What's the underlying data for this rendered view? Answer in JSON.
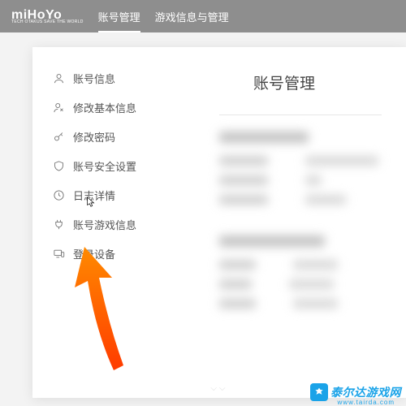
{
  "logo": {
    "main": "miHoYo",
    "sub": "TECH OTAKUS SAVE THE WORLD"
  },
  "nav": {
    "items": [
      {
        "label": "账号管理",
        "active": true
      },
      {
        "label": "游戏信息与管理",
        "active": false
      }
    ]
  },
  "sidebar": {
    "items": [
      {
        "icon": "user-icon",
        "label": "账号信息"
      },
      {
        "icon": "edit-user-icon",
        "label": "修改基本信息"
      },
      {
        "icon": "key-icon",
        "label": "修改密码"
      },
      {
        "icon": "shield-icon",
        "label": "账号安全设置"
      },
      {
        "icon": "clock-icon",
        "label": "日志详情"
      },
      {
        "icon": "plug-icon",
        "label": "账号游戏信息"
      },
      {
        "icon": "device-icon",
        "label": "登录设备"
      }
    ]
  },
  "content": {
    "heading": "账号管理"
  },
  "watermark": {
    "text": "泰尔达游戏网",
    "url": "www.tairda.com"
  }
}
